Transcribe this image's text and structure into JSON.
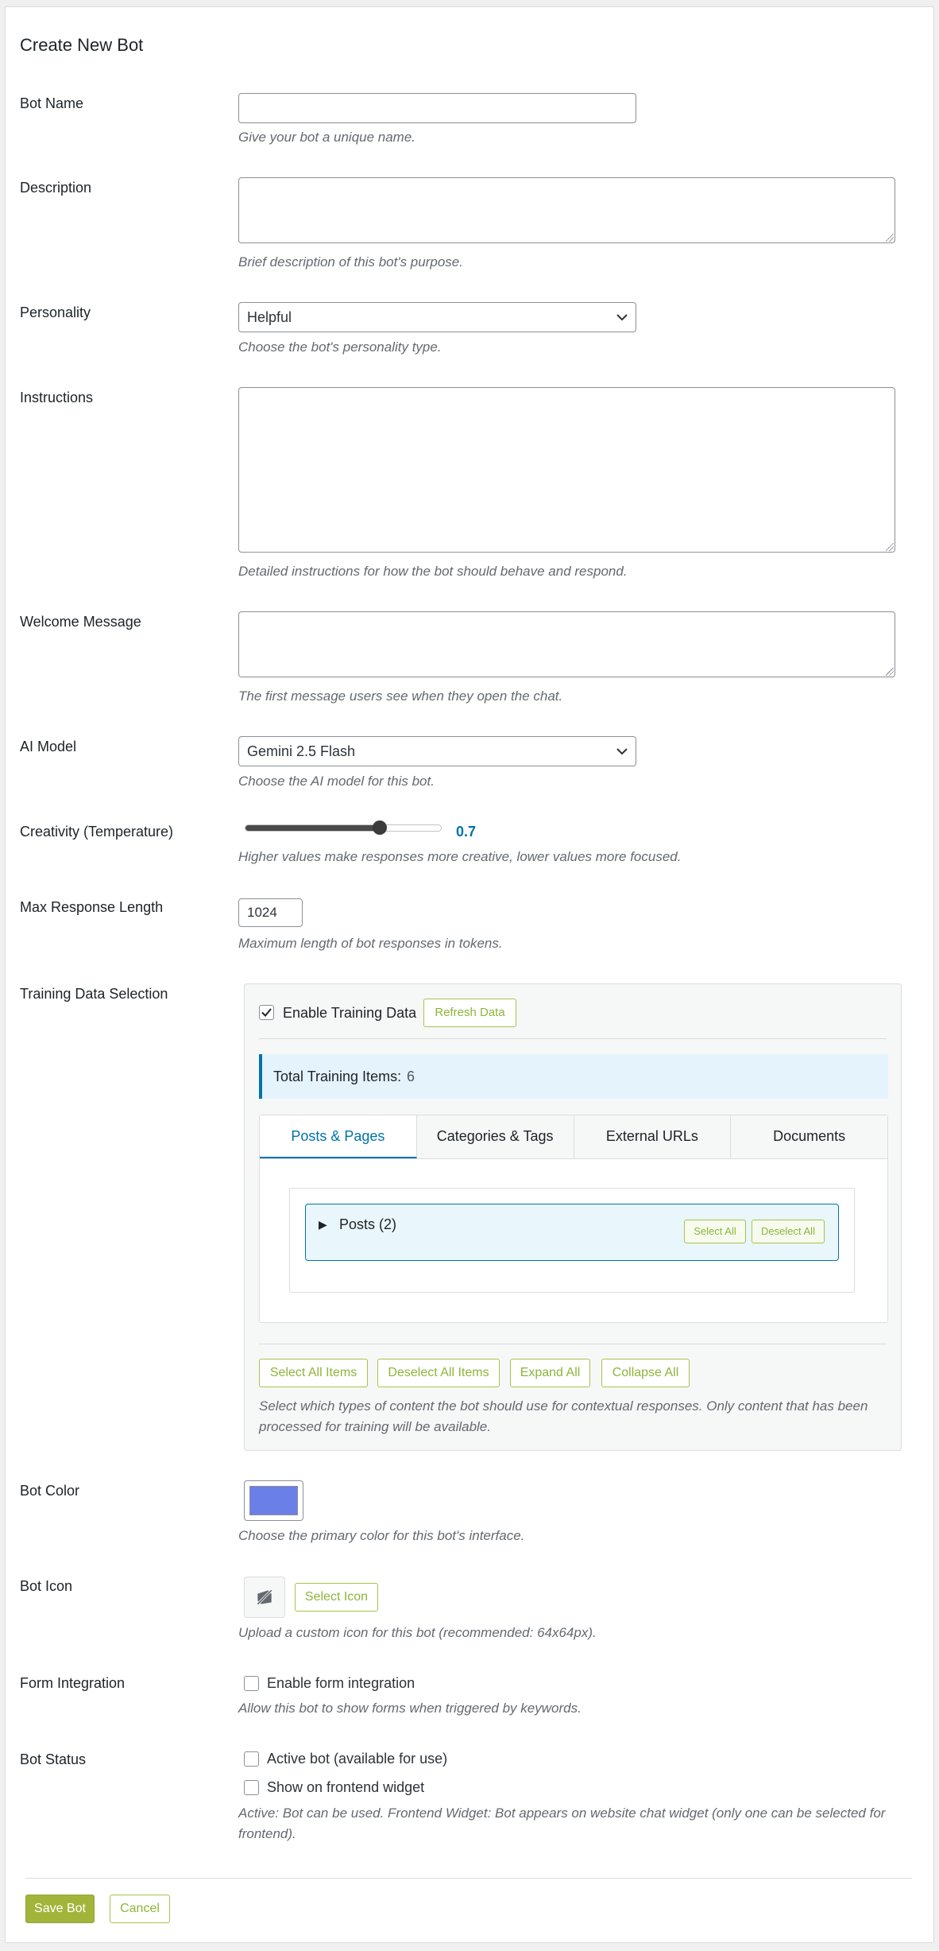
{
  "title": "Create New Bot",
  "fields": {
    "bot_name": {
      "label": "Bot Name",
      "value": "",
      "help": "Give your bot a unique name."
    },
    "description": {
      "label": "Description",
      "value": "",
      "help": "Brief description of this bot's purpose."
    },
    "personality": {
      "label": "Personality",
      "value": "Helpful",
      "help": "Choose the bot's personality type."
    },
    "instructions": {
      "label": "Instructions",
      "value": "",
      "help": "Detailed instructions for how the bot should behave and respond."
    },
    "welcome": {
      "label": "Welcome Message",
      "value": "",
      "help": "The first message users see when they open the chat."
    },
    "ai_model": {
      "label": "AI Model",
      "value": "Gemini 2.5 Flash",
      "help": "Choose the AI model for this bot."
    },
    "temperature": {
      "label": "Creativity (Temperature)",
      "value": "0.7",
      "slider_fraction": 0.7,
      "help": "Higher values make responses more creative, lower values more focused."
    },
    "max_length": {
      "label": "Max Response Length",
      "value": "1024",
      "help": "Maximum length of bot responses in tokens."
    },
    "training": {
      "label": "Training Data Selection",
      "enable_label": "Enable Training Data",
      "enabled": true,
      "refresh_label": "Refresh Data",
      "total_label": "Total Training Items:",
      "total_value": "6",
      "tabs": [
        "Posts & Pages",
        "Categories & Tags",
        "External URLs",
        "Documents"
      ],
      "active_tab": 0,
      "group": {
        "label": "Posts (2)",
        "select_all": "Select All",
        "deselect_all": "Deselect All"
      },
      "actions": [
        "Select All Items",
        "Deselect All Items",
        "Expand All",
        "Collapse All"
      ],
      "help": "Select which types of content the bot should use for contextual responses. Only content that has been processed for training will be available."
    },
    "bot_color": {
      "label": "Bot Color",
      "value": "#6b7fe8",
      "help": "Choose the primary color for this bot's interface."
    },
    "bot_icon": {
      "label": "Bot Icon",
      "icon": "no-image-icon",
      "button": "Select Icon",
      "help": "Upload a custom icon for this bot (recommended: 64x64px)."
    },
    "form_integration": {
      "label": "Form Integration",
      "checkbox": "Enable form integration",
      "checked": false,
      "help": "Allow this bot to show forms when triggered by keywords."
    },
    "bot_status": {
      "label": "Bot Status",
      "active": "Active bot (available for use)",
      "frontend": "Show on frontend widget",
      "help": "Active: Bot can be used. Frontend Widget: Bot appears on website chat widget (only one can be selected for frontend)."
    }
  },
  "buttons": {
    "save": "Save Bot",
    "cancel": "Cancel"
  },
  "colors": {
    "accent": "#0073aa",
    "button_green": "#a2b53a",
    "outline_green": "#8db53a"
  }
}
